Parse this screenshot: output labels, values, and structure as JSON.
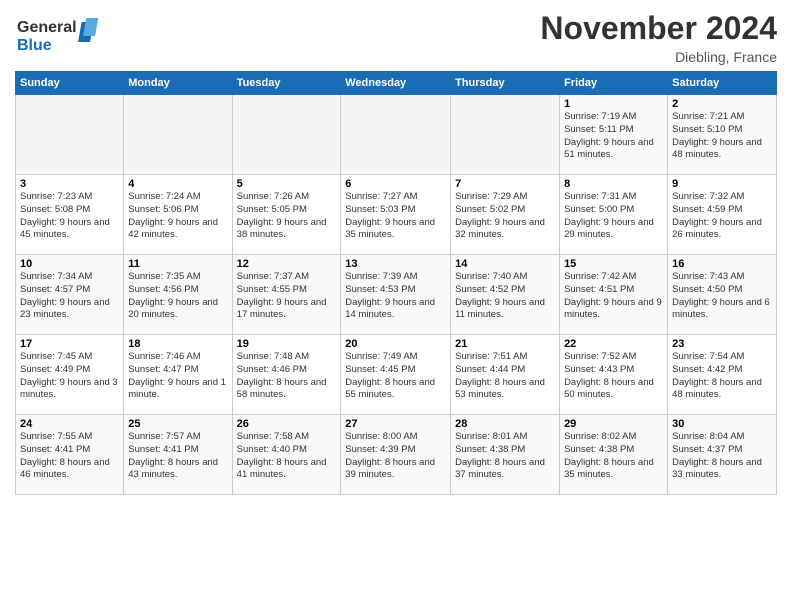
{
  "logo": {
    "line1": "General",
    "line2": "Blue"
  },
  "title": "November 2024",
  "location": "Diebling, France",
  "weekdays": [
    "Sunday",
    "Monday",
    "Tuesday",
    "Wednesday",
    "Thursday",
    "Friday",
    "Saturday"
  ],
  "weeks": [
    [
      {
        "day": "",
        "info": ""
      },
      {
        "day": "",
        "info": ""
      },
      {
        "day": "",
        "info": ""
      },
      {
        "day": "",
        "info": ""
      },
      {
        "day": "",
        "info": ""
      },
      {
        "day": "1",
        "info": "Sunrise: 7:19 AM\nSunset: 5:11 PM\nDaylight: 9 hours and 51 minutes."
      },
      {
        "day": "2",
        "info": "Sunrise: 7:21 AM\nSunset: 5:10 PM\nDaylight: 9 hours and 48 minutes."
      }
    ],
    [
      {
        "day": "3",
        "info": "Sunrise: 7:23 AM\nSunset: 5:08 PM\nDaylight: 9 hours and 45 minutes."
      },
      {
        "day": "4",
        "info": "Sunrise: 7:24 AM\nSunset: 5:06 PM\nDaylight: 9 hours and 42 minutes."
      },
      {
        "day": "5",
        "info": "Sunrise: 7:26 AM\nSunset: 5:05 PM\nDaylight: 9 hours and 38 minutes."
      },
      {
        "day": "6",
        "info": "Sunrise: 7:27 AM\nSunset: 5:03 PM\nDaylight: 9 hours and 35 minutes."
      },
      {
        "day": "7",
        "info": "Sunrise: 7:29 AM\nSunset: 5:02 PM\nDaylight: 9 hours and 32 minutes."
      },
      {
        "day": "8",
        "info": "Sunrise: 7:31 AM\nSunset: 5:00 PM\nDaylight: 9 hours and 29 minutes."
      },
      {
        "day": "9",
        "info": "Sunrise: 7:32 AM\nSunset: 4:59 PM\nDaylight: 9 hours and 26 minutes."
      }
    ],
    [
      {
        "day": "10",
        "info": "Sunrise: 7:34 AM\nSunset: 4:57 PM\nDaylight: 9 hours and 23 minutes."
      },
      {
        "day": "11",
        "info": "Sunrise: 7:35 AM\nSunset: 4:56 PM\nDaylight: 9 hours and 20 minutes."
      },
      {
        "day": "12",
        "info": "Sunrise: 7:37 AM\nSunset: 4:55 PM\nDaylight: 9 hours and 17 minutes."
      },
      {
        "day": "13",
        "info": "Sunrise: 7:39 AM\nSunset: 4:53 PM\nDaylight: 9 hours and 14 minutes."
      },
      {
        "day": "14",
        "info": "Sunrise: 7:40 AM\nSunset: 4:52 PM\nDaylight: 9 hours and 11 minutes."
      },
      {
        "day": "15",
        "info": "Sunrise: 7:42 AM\nSunset: 4:51 PM\nDaylight: 9 hours and 9 minutes."
      },
      {
        "day": "16",
        "info": "Sunrise: 7:43 AM\nSunset: 4:50 PM\nDaylight: 9 hours and 6 minutes."
      }
    ],
    [
      {
        "day": "17",
        "info": "Sunrise: 7:45 AM\nSunset: 4:49 PM\nDaylight: 9 hours and 3 minutes."
      },
      {
        "day": "18",
        "info": "Sunrise: 7:46 AM\nSunset: 4:47 PM\nDaylight: 9 hours and 1 minute."
      },
      {
        "day": "19",
        "info": "Sunrise: 7:48 AM\nSunset: 4:46 PM\nDaylight: 8 hours and 58 minutes."
      },
      {
        "day": "20",
        "info": "Sunrise: 7:49 AM\nSunset: 4:45 PM\nDaylight: 8 hours and 55 minutes."
      },
      {
        "day": "21",
        "info": "Sunrise: 7:51 AM\nSunset: 4:44 PM\nDaylight: 8 hours and 53 minutes."
      },
      {
        "day": "22",
        "info": "Sunrise: 7:52 AM\nSunset: 4:43 PM\nDaylight: 8 hours and 50 minutes."
      },
      {
        "day": "23",
        "info": "Sunrise: 7:54 AM\nSunset: 4:42 PM\nDaylight: 8 hours and 48 minutes."
      }
    ],
    [
      {
        "day": "24",
        "info": "Sunrise: 7:55 AM\nSunset: 4:41 PM\nDaylight: 8 hours and 46 minutes."
      },
      {
        "day": "25",
        "info": "Sunrise: 7:57 AM\nSunset: 4:41 PM\nDaylight: 8 hours and 43 minutes."
      },
      {
        "day": "26",
        "info": "Sunrise: 7:58 AM\nSunset: 4:40 PM\nDaylight: 8 hours and 41 minutes."
      },
      {
        "day": "27",
        "info": "Sunrise: 8:00 AM\nSunset: 4:39 PM\nDaylight: 8 hours and 39 minutes."
      },
      {
        "day": "28",
        "info": "Sunrise: 8:01 AM\nSunset: 4:38 PM\nDaylight: 8 hours and 37 minutes."
      },
      {
        "day": "29",
        "info": "Sunrise: 8:02 AM\nSunset: 4:38 PM\nDaylight: 8 hours and 35 minutes."
      },
      {
        "day": "30",
        "info": "Sunrise: 8:04 AM\nSunset: 4:37 PM\nDaylight: 8 hours and 33 minutes."
      }
    ]
  ]
}
